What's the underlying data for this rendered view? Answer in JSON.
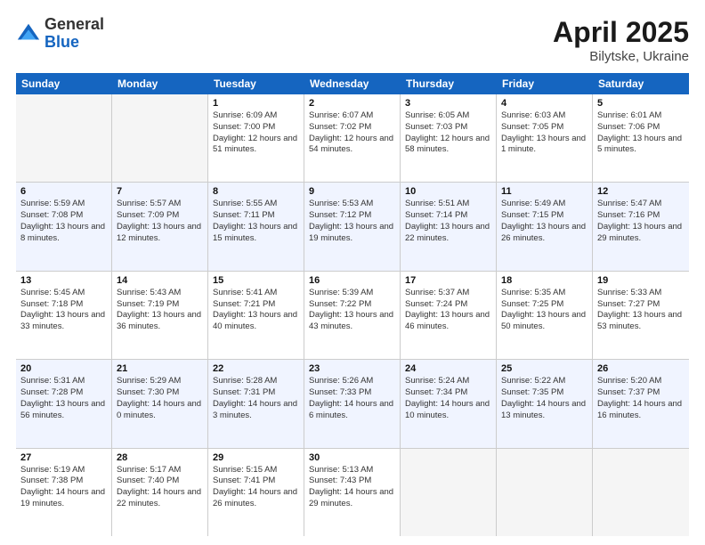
{
  "logo": {
    "general": "General",
    "blue": "Blue"
  },
  "title": {
    "month": "April 2025",
    "location": "Bilytske, Ukraine"
  },
  "header_days": [
    "Sunday",
    "Monday",
    "Tuesday",
    "Wednesday",
    "Thursday",
    "Friday",
    "Saturday"
  ],
  "weeks": [
    {
      "alt": false,
      "cells": [
        {
          "day": "",
          "empty": true,
          "info": ""
        },
        {
          "day": "",
          "empty": true,
          "info": ""
        },
        {
          "day": "1",
          "empty": false,
          "info": "Sunrise: 6:09 AM\nSunset: 7:00 PM\nDaylight: 12 hours and 51 minutes."
        },
        {
          "day": "2",
          "empty": false,
          "info": "Sunrise: 6:07 AM\nSunset: 7:02 PM\nDaylight: 12 hours and 54 minutes."
        },
        {
          "day": "3",
          "empty": false,
          "info": "Sunrise: 6:05 AM\nSunset: 7:03 PM\nDaylight: 12 hours and 58 minutes."
        },
        {
          "day": "4",
          "empty": false,
          "info": "Sunrise: 6:03 AM\nSunset: 7:05 PM\nDaylight: 13 hours and 1 minute."
        },
        {
          "day": "5",
          "empty": false,
          "info": "Sunrise: 6:01 AM\nSunset: 7:06 PM\nDaylight: 13 hours and 5 minutes."
        }
      ]
    },
    {
      "alt": true,
      "cells": [
        {
          "day": "6",
          "empty": false,
          "info": "Sunrise: 5:59 AM\nSunset: 7:08 PM\nDaylight: 13 hours and 8 minutes."
        },
        {
          "day": "7",
          "empty": false,
          "info": "Sunrise: 5:57 AM\nSunset: 7:09 PM\nDaylight: 13 hours and 12 minutes."
        },
        {
          "day": "8",
          "empty": false,
          "info": "Sunrise: 5:55 AM\nSunset: 7:11 PM\nDaylight: 13 hours and 15 minutes."
        },
        {
          "day": "9",
          "empty": false,
          "info": "Sunrise: 5:53 AM\nSunset: 7:12 PM\nDaylight: 13 hours and 19 minutes."
        },
        {
          "day": "10",
          "empty": false,
          "info": "Sunrise: 5:51 AM\nSunset: 7:14 PM\nDaylight: 13 hours and 22 minutes."
        },
        {
          "day": "11",
          "empty": false,
          "info": "Sunrise: 5:49 AM\nSunset: 7:15 PM\nDaylight: 13 hours and 26 minutes."
        },
        {
          "day": "12",
          "empty": false,
          "info": "Sunrise: 5:47 AM\nSunset: 7:16 PM\nDaylight: 13 hours and 29 minutes."
        }
      ]
    },
    {
      "alt": false,
      "cells": [
        {
          "day": "13",
          "empty": false,
          "info": "Sunrise: 5:45 AM\nSunset: 7:18 PM\nDaylight: 13 hours and 33 minutes."
        },
        {
          "day": "14",
          "empty": false,
          "info": "Sunrise: 5:43 AM\nSunset: 7:19 PM\nDaylight: 13 hours and 36 minutes."
        },
        {
          "day": "15",
          "empty": false,
          "info": "Sunrise: 5:41 AM\nSunset: 7:21 PM\nDaylight: 13 hours and 40 minutes."
        },
        {
          "day": "16",
          "empty": false,
          "info": "Sunrise: 5:39 AM\nSunset: 7:22 PM\nDaylight: 13 hours and 43 minutes."
        },
        {
          "day": "17",
          "empty": false,
          "info": "Sunrise: 5:37 AM\nSunset: 7:24 PM\nDaylight: 13 hours and 46 minutes."
        },
        {
          "day": "18",
          "empty": false,
          "info": "Sunrise: 5:35 AM\nSunset: 7:25 PM\nDaylight: 13 hours and 50 minutes."
        },
        {
          "day": "19",
          "empty": false,
          "info": "Sunrise: 5:33 AM\nSunset: 7:27 PM\nDaylight: 13 hours and 53 minutes."
        }
      ]
    },
    {
      "alt": true,
      "cells": [
        {
          "day": "20",
          "empty": false,
          "info": "Sunrise: 5:31 AM\nSunset: 7:28 PM\nDaylight: 13 hours and 56 minutes."
        },
        {
          "day": "21",
          "empty": false,
          "info": "Sunrise: 5:29 AM\nSunset: 7:30 PM\nDaylight: 14 hours and 0 minutes."
        },
        {
          "day": "22",
          "empty": false,
          "info": "Sunrise: 5:28 AM\nSunset: 7:31 PM\nDaylight: 14 hours and 3 minutes."
        },
        {
          "day": "23",
          "empty": false,
          "info": "Sunrise: 5:26 AM\nSunset: 7:33 PM\nDaylight: 14 hours and 6 minutes."
        },
        {
          "day": "24",
          "empty": false,
          "info": "Sunrise: 5:24 AM\nSunset: 7:34 PM\nDaylight: 14 hours and 10 minutes."
        },
        {
          "day": "25",
          "empty": false,
          "info": "Sunrise: 5:22 AM\nSunset: 7:35 PM\nDaylight: 14 hours and 13 minutes."
        },
        {
          "day": "26",
          "empty": false,
          "info": "Sunrise: 5:20 AM\nSunset: 7:37 PM\nDaylight: 14 hours and 16 minutes."
        }
      ]
    },
    {
      "alt": false,
      "cells": [
        {
          "day": "27",
          "empty": false,
          "info": "Sunrise: 5:19 AM\nSunset: 7:38 PM\nDaylight: 14 hours and 19 minutes."
        },
        {
          "day": "28",
          "empty": false,
          "info": "Sunrise: 5:17 AM\nSunset: 7:40 PM\nDaylight: 14 hours and 22 minutes."
        },
        {
          "day": "29",
          "empty": false,
          "info": "Sunrise: 5:15 AM\nSunset: 7:41 PM\nDaylight: 14 hours and 26 minutes."
        },
        {
          "day": "30",
          "empty": false,
          "info": "Sunrise: 5:13 AM\nSunset: 7:43 PM\nDaylight: 14 hours and 29 minutes."
        },
        {
          "day": "",
          "empty": true,
          "info": ""
        },
        {
          "day": "",
          "empty": true,
          "info": ""
        },
        {
          "day": "",
          "empty": true,
          "info": ""
        }
      ]
    }
  ]
}
